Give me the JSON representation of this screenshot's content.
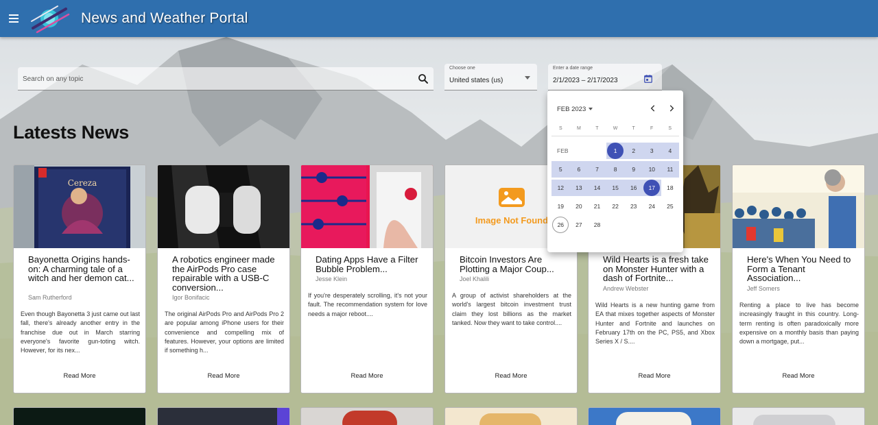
{
  "header": {
    "title": "News and Weather Portal"
  },
  "search": {
    "placeholder": "Search on any topic"
  },
  "country": {
    "label": "Choose one",
    "value": "United states (us)"
  },
  "daterange": {
    "label": "Enter a date range",
    "value": "2/1/2023 – 2/17/2023"
  },
  "section": {
    "title": "Latests News"
  },
  "cards": [
    {
      "title": "Bayonetta Origins hands-on: A charming tale of a witch and her demon cat...",
      "author": "Sam Rutherford",
      "desc": "Even though Bayonetta 3 just came out last fall, there's already another entry in the franchise due out in March starring everyone's favorite gun-toting witch. However, for its nex...",
      "more": "Read More"
    },
    {
      "title": "A robotics engineer made the AirPods Pro case repairable with a USB-C conversion...",
      "author": "Igor Bonifacic",
      "desc": "The original AirPods Pro and AirPods Pro 2 are popular among iPhone users for their convenience and compelling mix of features. However, your options are limited if something h...",
      "more": "Read More"
    },
    {
      "title": "Dating Apps Have a Filter Bubble Problem...",
      "author": "Jesse Klein",
      "desc": "If you're desperately scrolling, it's not your fault. The recommendation system for love needs a major reboot....",
      "more": "Read More"
    },
    {
      "title": "Bitcoin Investors Are Plotting a Major Coup...",
      "author": "Joel Khalili",
      "desc": "A group of activist shareholders at the world's largest bitcoin investment trust claim they lost billions as the market tanked. Now they want to take control....",
      "more": "Read More",
      "image_text": "Image Not Found"
    },
    {
      "title": "Wild Hearts is a fresh take on Monster Hunter with a dash of Fortnite...",
      "author": "Andrew Webster",
      "desc": "Wild Hearts is a new hunting game from EA that mixes together aspects of Monster Hunter and Fortnite and launches on February 17th on the PC, PS5, and Xbox Series X / S....",
      "more": "Read More"
    },
    {
      "title": "Here's When You Need to Form a Tenant Association...",
      "author": "Jeff Somers",
      "desc": "Renting a place to live has become increasingly fraught in this country. Long-term renting is often paradoxically more expensive on a monthly basis than paying down a mortgage, put...",
      "more": "Read More"
    }
  ],
  "datepicker": {
    "period": "FEB 2023",
    "weekdays": [
      "S",
      "M",
      "T",
      "W",
      "T",
      "F",
      "S"
    ],
    "month_label": "FEB",
    "days": [
      "1",
      "2",
      "3",
      "4",
      "5",
      "6",
      "7",
      "8",
      "9",
      "10",
      "11",
      "12",
      "13",
      "14",
      "15",
      "16",
      "17",
      "18",
      "19",
      "20",
      "21",
      "22",
      "23",
      "24",
      "25",
      "26",
      "27",
      "28"
    ],
    "range_start": 1,
    "range_end": 17,
    "today": 26,
    "accent": "#3f51b5"
  },
  "colors": {
    "header": "#2f6fae",
    "accent": "#3f51b5",
    "range": "#cfd6ef"
  }
}
